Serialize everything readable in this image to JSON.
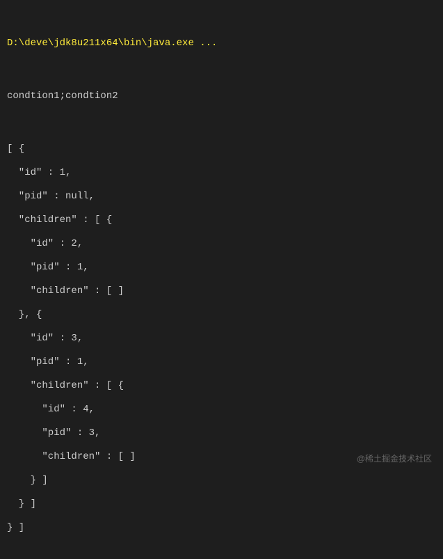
{
  "console": {
    "command": "D:\\deve\\jdk8u211x64\\bin\\java.exe ...",
    "output1": "condtion1;condtion2",
    "lines": [
      "[ {",
      "  \"id\" : 1,",
      "  \"pid\" : null,",
      "  \"children\" : [ {",
      "    \"id\" : 2,",
      "    \"pid\" : 1,",
      "    \"children\" : [ ]",
      "  }, {",
      "    \"id\" : 3,",
      "    \"pid\" : 1,",
      "    \"children\" : [ {",
      "      \"id\" : 4,",
      "      \"pid\" : 3,",
      "      \"children\" : [ ]",
      "    } ]",
      "  } ]",
      "} ]"
    ]
  },
  "watermark": "@稀土掘金技术社区"
}
